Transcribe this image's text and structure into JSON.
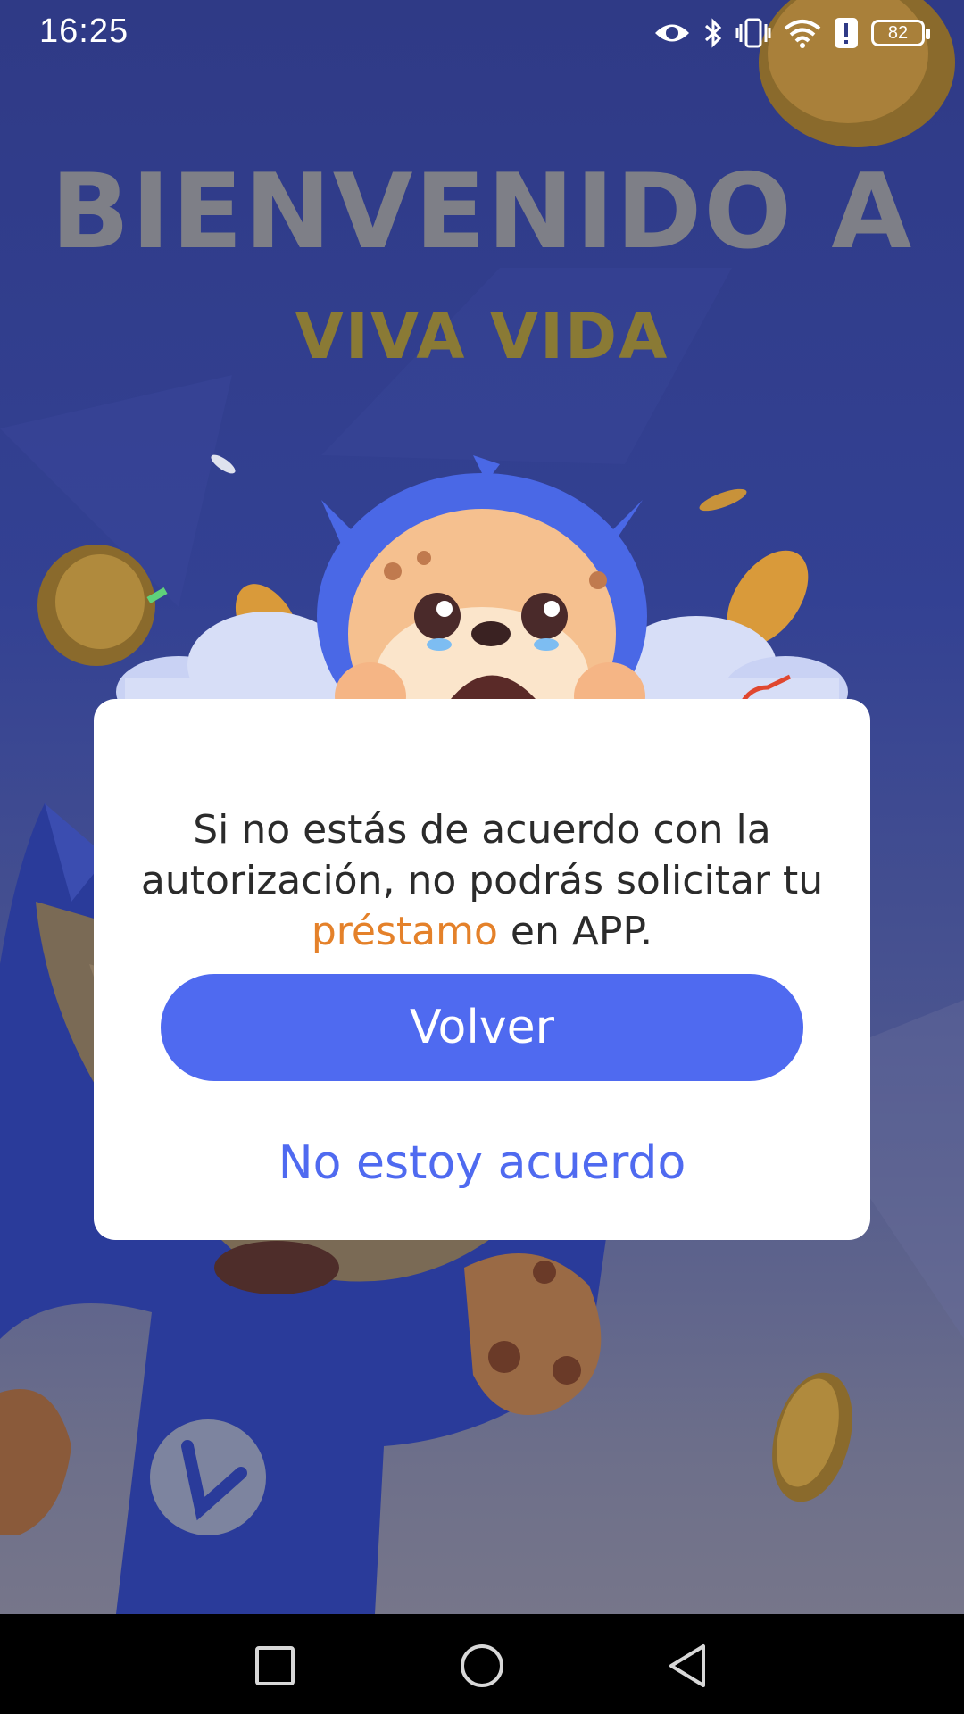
{
  "status_bar": {
    "time": "16:25",
    "battery_level": "82",
    "icons": [
      "eye-icon",
      "bluetooth-icon",
      "vibrate-icon",
      "wifi-icon",
      "alert-icon",
      "battery-icon"
    ]
  },
  "background": {
    "welcome_title": "BIENVENIDO A",
    "brand_title": "VIVA VIDA"
  },
  "dialog": {
    "message_before": "Si no estás de acuerdo con la autorización, no podrás solicitar tu ",
    "message_highlight": "préstamo",
    "message_after": " en APP.",
    "primary_button": "Volver",
    "secondary_button": "No estoy acuerdo",
    "accent_color": "#4f6af0",
    "highlight_color": "#e4812a"
  },
  "nav_bar": {
    "buttons": [
      "recent-apps-icon",
      "home-icon",
      "back-icon"
    ]
  }
}
